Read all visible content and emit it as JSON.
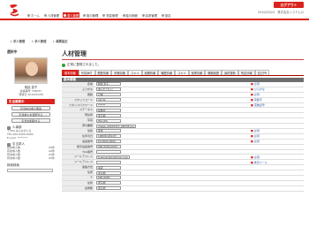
{
  "header": {
    "logout_label": "ログアウト",
    "info": "2010/03/24　株式会社システムロ",
    "brand_color": "#d9231c"
  },
  "menu": [
    {
      "label": "ホーム",
      "active": false
    },
    {
      "label": "人材管理",
      "active": false
    },
    {
      "label": "求人管理",
      "active": true
    },
    {
      "label": "取引管理",
      "active": false
    },
    {
      "label": "勤怠管理",
      "active": false
    },
    {
      "label": "給与明細",
      "active": false
    },
    {
      "label": "請求管理",
      "active": false
    },
    {
      "label": "設定",
      "active": false
    }
  ],
  "breadcrumb": [
    "求人管理",
    "求人管理",
    "帳票設定"
  ],
  "sidebar": {
    "title": "選択中",
    "name": "相談 恵子",
    "meta1": "会員番号 796037",
    "meta2": "登録日 2010/03/08",
    "section_label": "引当業務中",
    "buttons": [
      "引当中の求人照会",
      "引当求人を選択する",
      "引当を削除する"
    ],
    "contact_head": "人事部",
    "contact_lines": [
      "〒000 みんながいる",
      "TEL 000-0000-0000",
      "E-mail: ********"
    ],
    "list_head": "引当求人",
    "list_rows": [
      [
        "有効求人数",
        "00件"
      ],
      [
        "有効求人数",
        "00件"
      ],
      [
        "有効求人数",
        "00件"
      ],
      [
        "有効求人数",
        "00件"
      ]
    ],
    "search_head": "検索検索",
    "search_placeholder": ""
  },
  "main": {
    "title": "人材管理",
    "notice": "正常に登録されました。",
    "tabs": [
      "基本情報",
      "写真添付",
      "履歴情報",
      "資格情報",
      "スキル",
      "経験情報",
      "職歴情報",
      "スキル",
      "就業情報",
      "職務経歴",
      "最終更新",
      "所定情報",
      "自己PR"
    ],
    "active_tab": 0,
    "section": "基本情報"
  },
  "form": {
    "rows": [
      {
        "label": "名前",
        "value": "相談 恵子",
        "note": "必須"
      },
      {
        "label": "ふりがな",
        "value": "あいだ けいこ",
        "note": "ひらがな"
      },
      {
        "label": "国籍",
        "value": "日本",
        "note": "必須"
      },
      {
        "label": "スタッフコード",
        "value": "abcde",
        "note": "英数字"
      },
      {
        "label": "スタッフパスワード",
        "value": "******",
        "note": "英数記号"
      },
      {
        "label": "ステータス",
        "value": "在籍中",
        "note": ""
      },
      {
        "label": "現住所",
        "value": "東京都",
        "note": ""
      },
      {
        "label": "写真",
        "value": "841.JPG",
        "note": ""
      },
      {
        "label": "添付書類",
        "value": "image_20100323_ABCDE.jpg",
        "note": ""
      },
      {
        "label": "性別",
        "value": "女性",
        "note": "必須"
      },
      {
        "label": "生年月日",
        "value": "1980年4月24日",
        "note": "必須"
      },
      {
        "label": "電話番号",
        "value": "03-0000-0000",
        "note": "必須"
      },
      {
        "label": "携帯電話番号",
        "value": "090-0000-0000",
        "note": ""
      },
      {
        "label": "FAX番号",
        "value": "",
        "note": ""
      },
      {
        "label": "メールアドレス",
        "value": "foreuser@example.co.jp",
        "note": "必須"
      },
      {
        "label": "メールアドレス",
        "value": "",
        "note": "携帯メール"
      },
      {
        "label": "連絡方法",
        "value": "電話",
        "note": ""
      },
      {
        "label": "住所",
        "value": "東京都",
        "note": ""
      },
      {
        "label": "〒",
        "value": "000-0000",
        "note": ""
      },
      {
        "label": "住所",
        "value": "東京都",
        "note": ""
      },
      {
        "label": "最寄駅",
        "value": "東京駅",
        "note": ""
      }
    ]
  }
}
